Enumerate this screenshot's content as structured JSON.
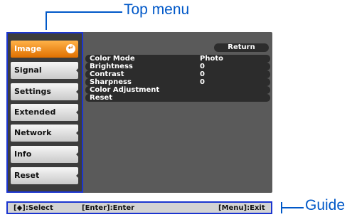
{
  "callouts": {
    "top_menu": "Top menu",
    "guide": "Guide"
  },
  "sidebar": {
    "items": [
      {
        "label": "Image",
        "active": true
      },
      {
        "label": "Signal"
      },
      {
        "label": "Settings"
      },
      {
        "label": "Extended"
      },
      {
        "label": "Network"
      },
      {
        "label": "Info"
      },
      {
        "label": "Reset"
      }
    ],
    "enter_icon": "enter-arrow-icon"
  },
  "main": {
    "return_label": "Return",
    "rows": [
      {
        "label": "Color Mode",
        "value": "Photo"
      },
      {
        "label": "Brightness",
        "value": "0"
      },
      {
        "label": "Contrast",
        "value": "0"
      },
      {
        "label": "Sharpness",
        "value": "0"
      },
      {
        "label": "Color Adjustment",
        "value": ""
      },
      {
        "label": "Reset",
        "value": ""
      }
    ]
  },
  "guide_bar": {
    "select": "[◆]:Select",
    "enter": "[Enter]:Enter",
    "exit": "[Menu]:Exit"
  },
  "colors": {
    "accent": "#0058c8",
    "active_tab": "#e07000",
    "frame": "#1b35d0",
    "screen": "#5a5a5a"
  }
}
